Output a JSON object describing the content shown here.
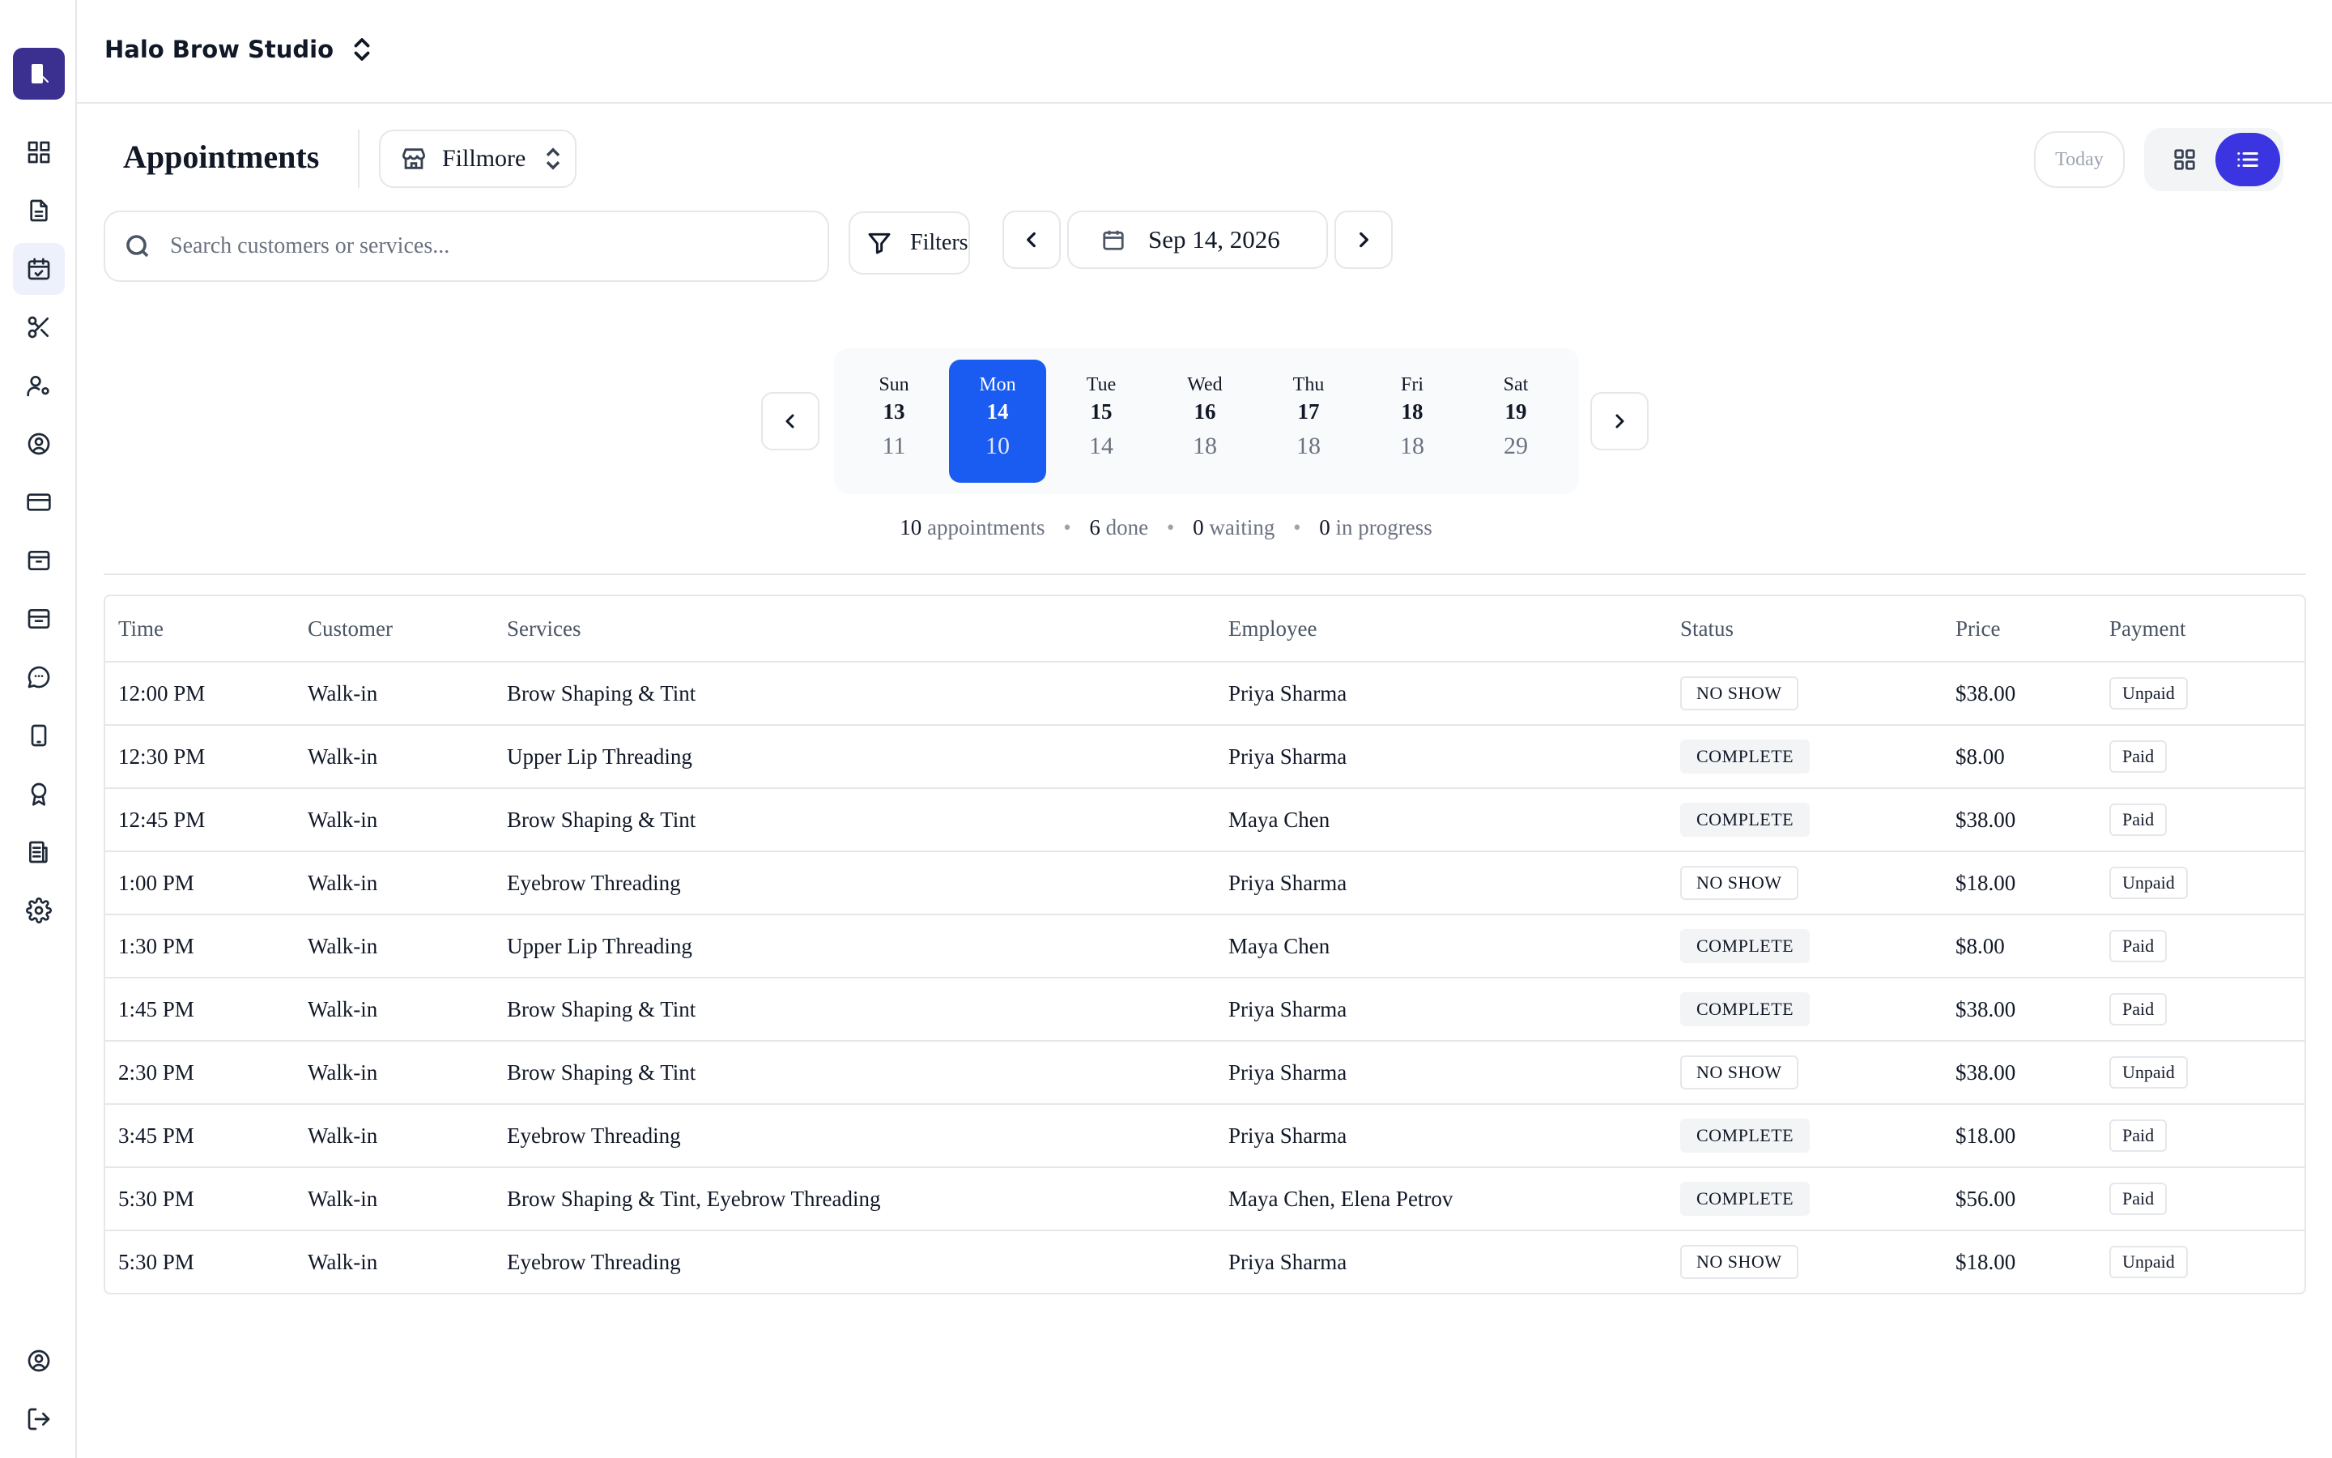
{
  "business": {
    "name": "Halo Brow Studio"
  },
  "page": {
    "title": "Appointments",
    "location": "Fillmore"
  },
  "controls": {
    "today_label": "Today",
    "search_placeholder": "Search customers or services...",
    "filters_label": "Filters",
    "date_label": "Sep 14, 2026"
  },
  "week": [
    {
      "day": "Sun",
      "date": "13",
      "count": "11"
    },
    {
      "day": "Mon",
      "date": "14",
      "count": "10",
      "selected": true
    },
    {
      "day": "Tue",
      "date": "15",
      "count": "14"
    },
    {
      "day": "Wed",
      "date": "16",
      "count": "18"
    },
    {
      "day": "Thu",
      "date": "17",
      "count": "18"
    },
    {
      "day": "Fri",
      "date": "18",
      "count": "18"
    },
    {
      "day": "Sat",
      "date": "19",
      "count": "29"
    }
  ],
  "summary": {
    "appointments": "10",
    "appointments_label": "appointments",
    "done": "6",
    "done_label": "done",
    "waiting": "0",
    "waiting_label": "waiting",
    "in_progress": "0",
    "in_progress_label": "in progress"
  },
  "table": {
    "headers": [
      "Time",
      "Customer",
      "Services",
      "Employee",
      "Status",
      "Price",
      "Payment"
    ],
    "rows": [
      {
        "time": "12:00 PM",
        "customer": "Walk-in",
        "services": "Brow Shaping & Tint",
        "employee": "Priya Sharma",
        "status": "NO SHOW",
        "price": "$38.00",
        "payment": "Unpaid"
      },
      {
        "time": "12:30 PM",
        "customer": "Walk-in",
        "services": "Upper Lip Threading",
        "employee": "Priya Sharma",
        "status": "COMPLETE",
        "price": "$8.00",
        "payment": "Paid"
      },
      {
        "time": "12:45 PM",
        "customer": "Walk-in",
        "services": "Brow Shaping & Tint",
        "employee": "Maya Chen",
        "status": "COMPLETE",
        "price": "$38.00",
        "payment": "Paid"
      },
      {
        "time": "1:00 PM",
        "customer": "Walk-in",
        "services": "Eyebrow Threading",
        "employee": "Priya Sharma",
        "status": "NO SHOW",
        "price": "$18.00",
        "payment": "Unpaid"
      },
      {
        "time": "1:30 PM",
        "customer": "Walk-in",
        "services": "Upper Lip Threading",
        "employee": "Maya Chen",
        "status": "COMPLETE",
        "price": "$8.00",
        "payment": "Paid"
      },
      {
        "time": "1:45 PM",
        "customer": "Walk-in",
        "services": "Brow Shaping & Tint",
        "employee": "Priya Sharma",
        "status": "COMPLETE",
        "price": "$38.00",
        "payment": "Paid"
      },
      {
        "time": "2:30 PM",
        "customer": "Walk-in",
        "services": "Brow Shaping & Tint",
        "employee": "Priya Sharma",
        "status": "NO SHOW",
        "price": "$38.00",
        "payment": "Unpaid"
      },
      {
        "time": "3:45 PM",
        "customer": "Walk-in",
        "services": "Eyebrow Threading",
        "employee": "Priya Sharma",
        "status": "COMPLETE",
        "price": "$18.00",
        "payment": "Paid"
      },
      {
        "time": "5:30 PM",
        "customer": "Walk-in",
        "services": "Brow Shaping & Tint, Eyebrow Threading",
        "employee": "Maya Chen, Elena Petrov",
        "status": "COMPLETE",
        "price": "$56.00",
        "payment": "Paid"
      },
      {
        "time": "5:30 PM",
        "customer": "Walk-in",
        "services": "Eyebrow Threading",
        "employee": "Priya Sharma",
        "status": "NO SHOW",
        "price": "$18.00",
        "payment": "Unpaid"
      }
    ]
  },
  "sidebar": {
    "items": [
      {
        "icon": "dashboard-icon"
      },
      {
        "icon": "document-icon"
      },
      {
        "icon": "calendar-check-icon",
        "active": true
      },
      {
        "icon": "scissors-icon"
      },
      {
        "icon": "user-settings-icon"
      },
      {
        "icon": "user-circle-icon"
      },
      {
        "icon": "credit-card-icon"
      },
      {
        "icon": "inbox-icon"
      },
      {
        "icon": "archive-icon"
      },
      {
        "icon": "chat-icon"
      },
      {
        "icon": "tablet-icon"
      },
      {
        "icon": "award-icon"
      },
      {
        "icon": "receipt-icon"
      },
      {
        "icon": "gear-icon"
      }
    ],
    "bottom": [
      {
        "icon": "account-icon"
      },
      {
        "icon": "logout-icon"
      }
    ]
  },
  "colors": {
    "accent": "#3a35e0",
    "selected_day": "#1a5cf2",
    "logo_bg": "#3b2f8f"
  }
}
